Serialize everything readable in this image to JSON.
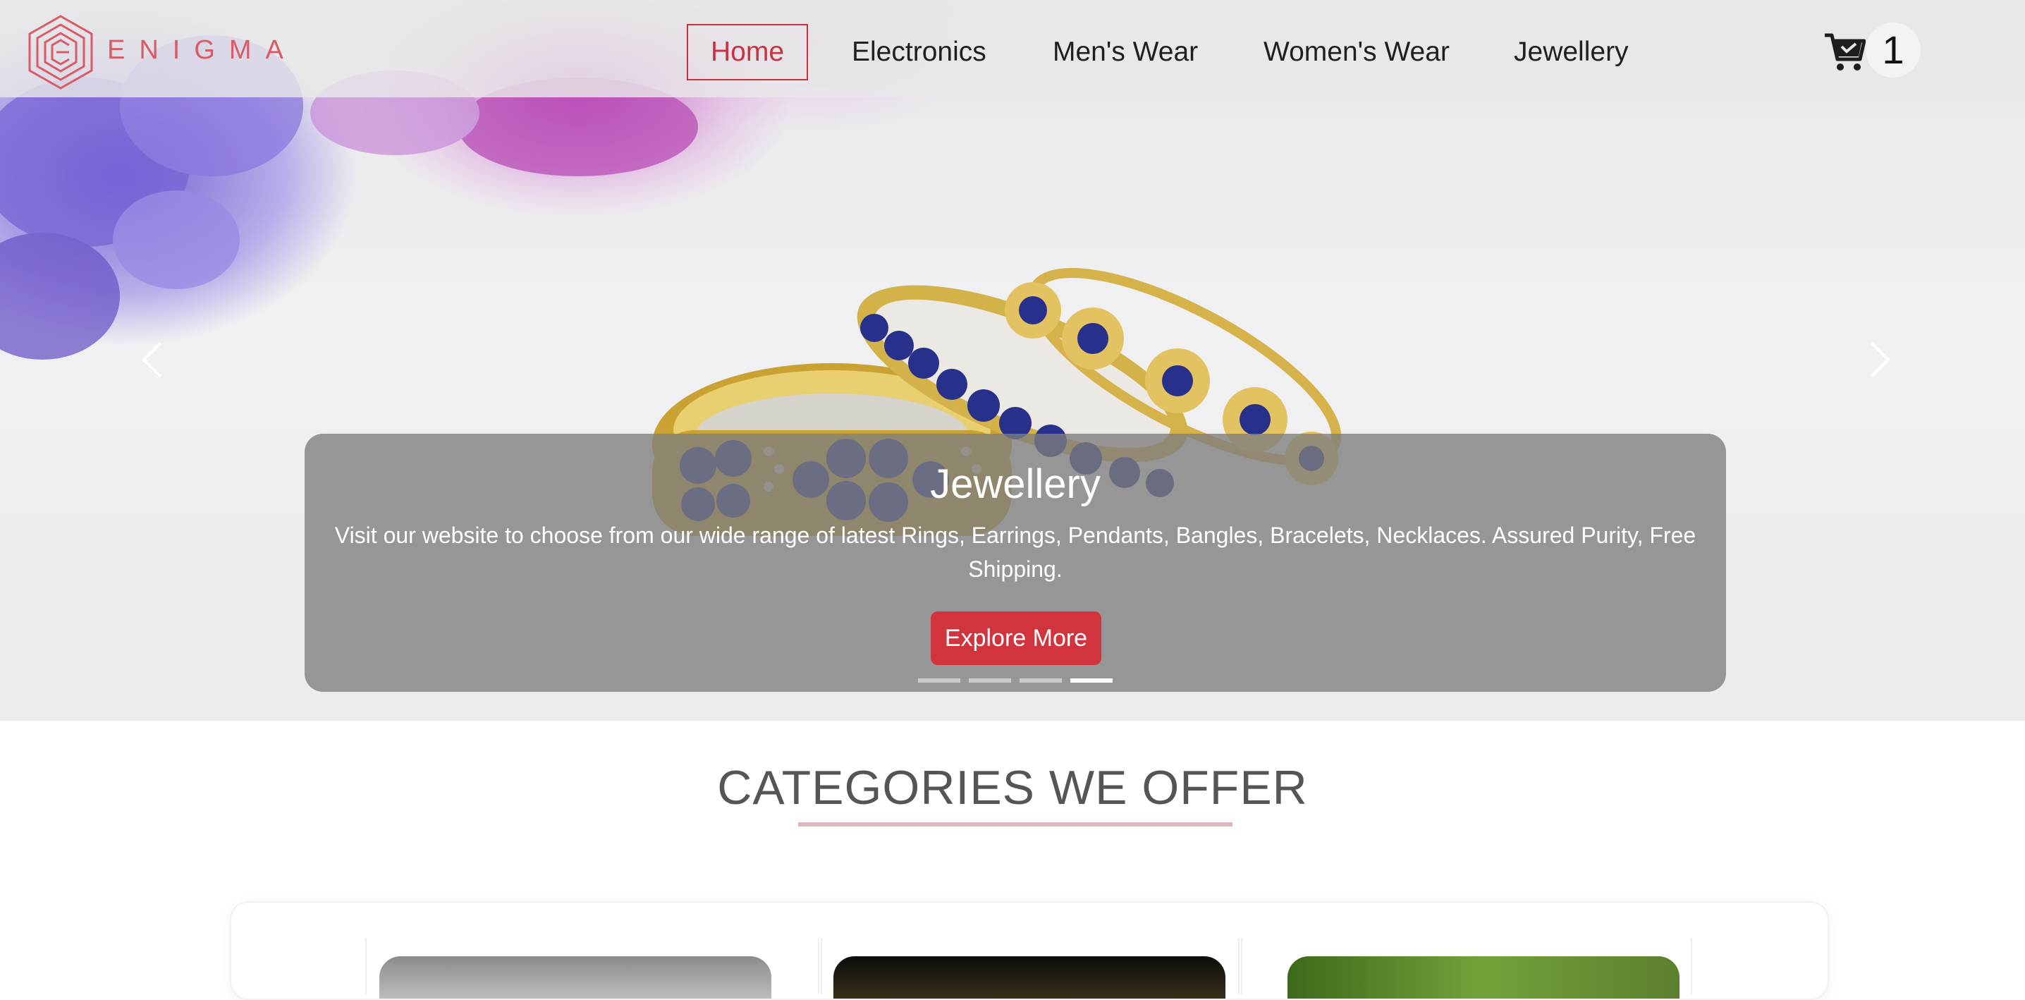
{
  "brand": {
    "name": "ENIGMA",
    "color": "#d95b66"
  },
  "nav": {
    "items": [
      {
        "label": "Home",
        "active": true
      },
      {
        "label": "Electronics",
        "active": false
      },
      {
        "label": "Men's Wear",
        "active": false
      },
      {
        "label": "Women's Wear",
        "active": false
      },
      {
        "label": "Jewellery",
        "active": false
      }
    ],
    "cart_count": "1"
  },
  "carousel": {
    "title": "Jewellery",
    "description": "Visit our website to choose from our wide range of latest Rings, Earrings, Pendants, Bangles, Bracelets, Necklaces. Assured Purity, Free Shipping.",
    "button_label": "Explore More",
    "slides": 4,
    "active_slide": 4,
    "prev_icon": "chevron-left-icon",
    "next_icon": "chevron-right-icon"
  },
  "categories": {
    "heading": "CATEGORIES WE OFFER"
  },
  "colors": {
    "accent": "#c8323f",
    "button": "#d2343e",
    "underline": "#dcb7bb"
  }
}
